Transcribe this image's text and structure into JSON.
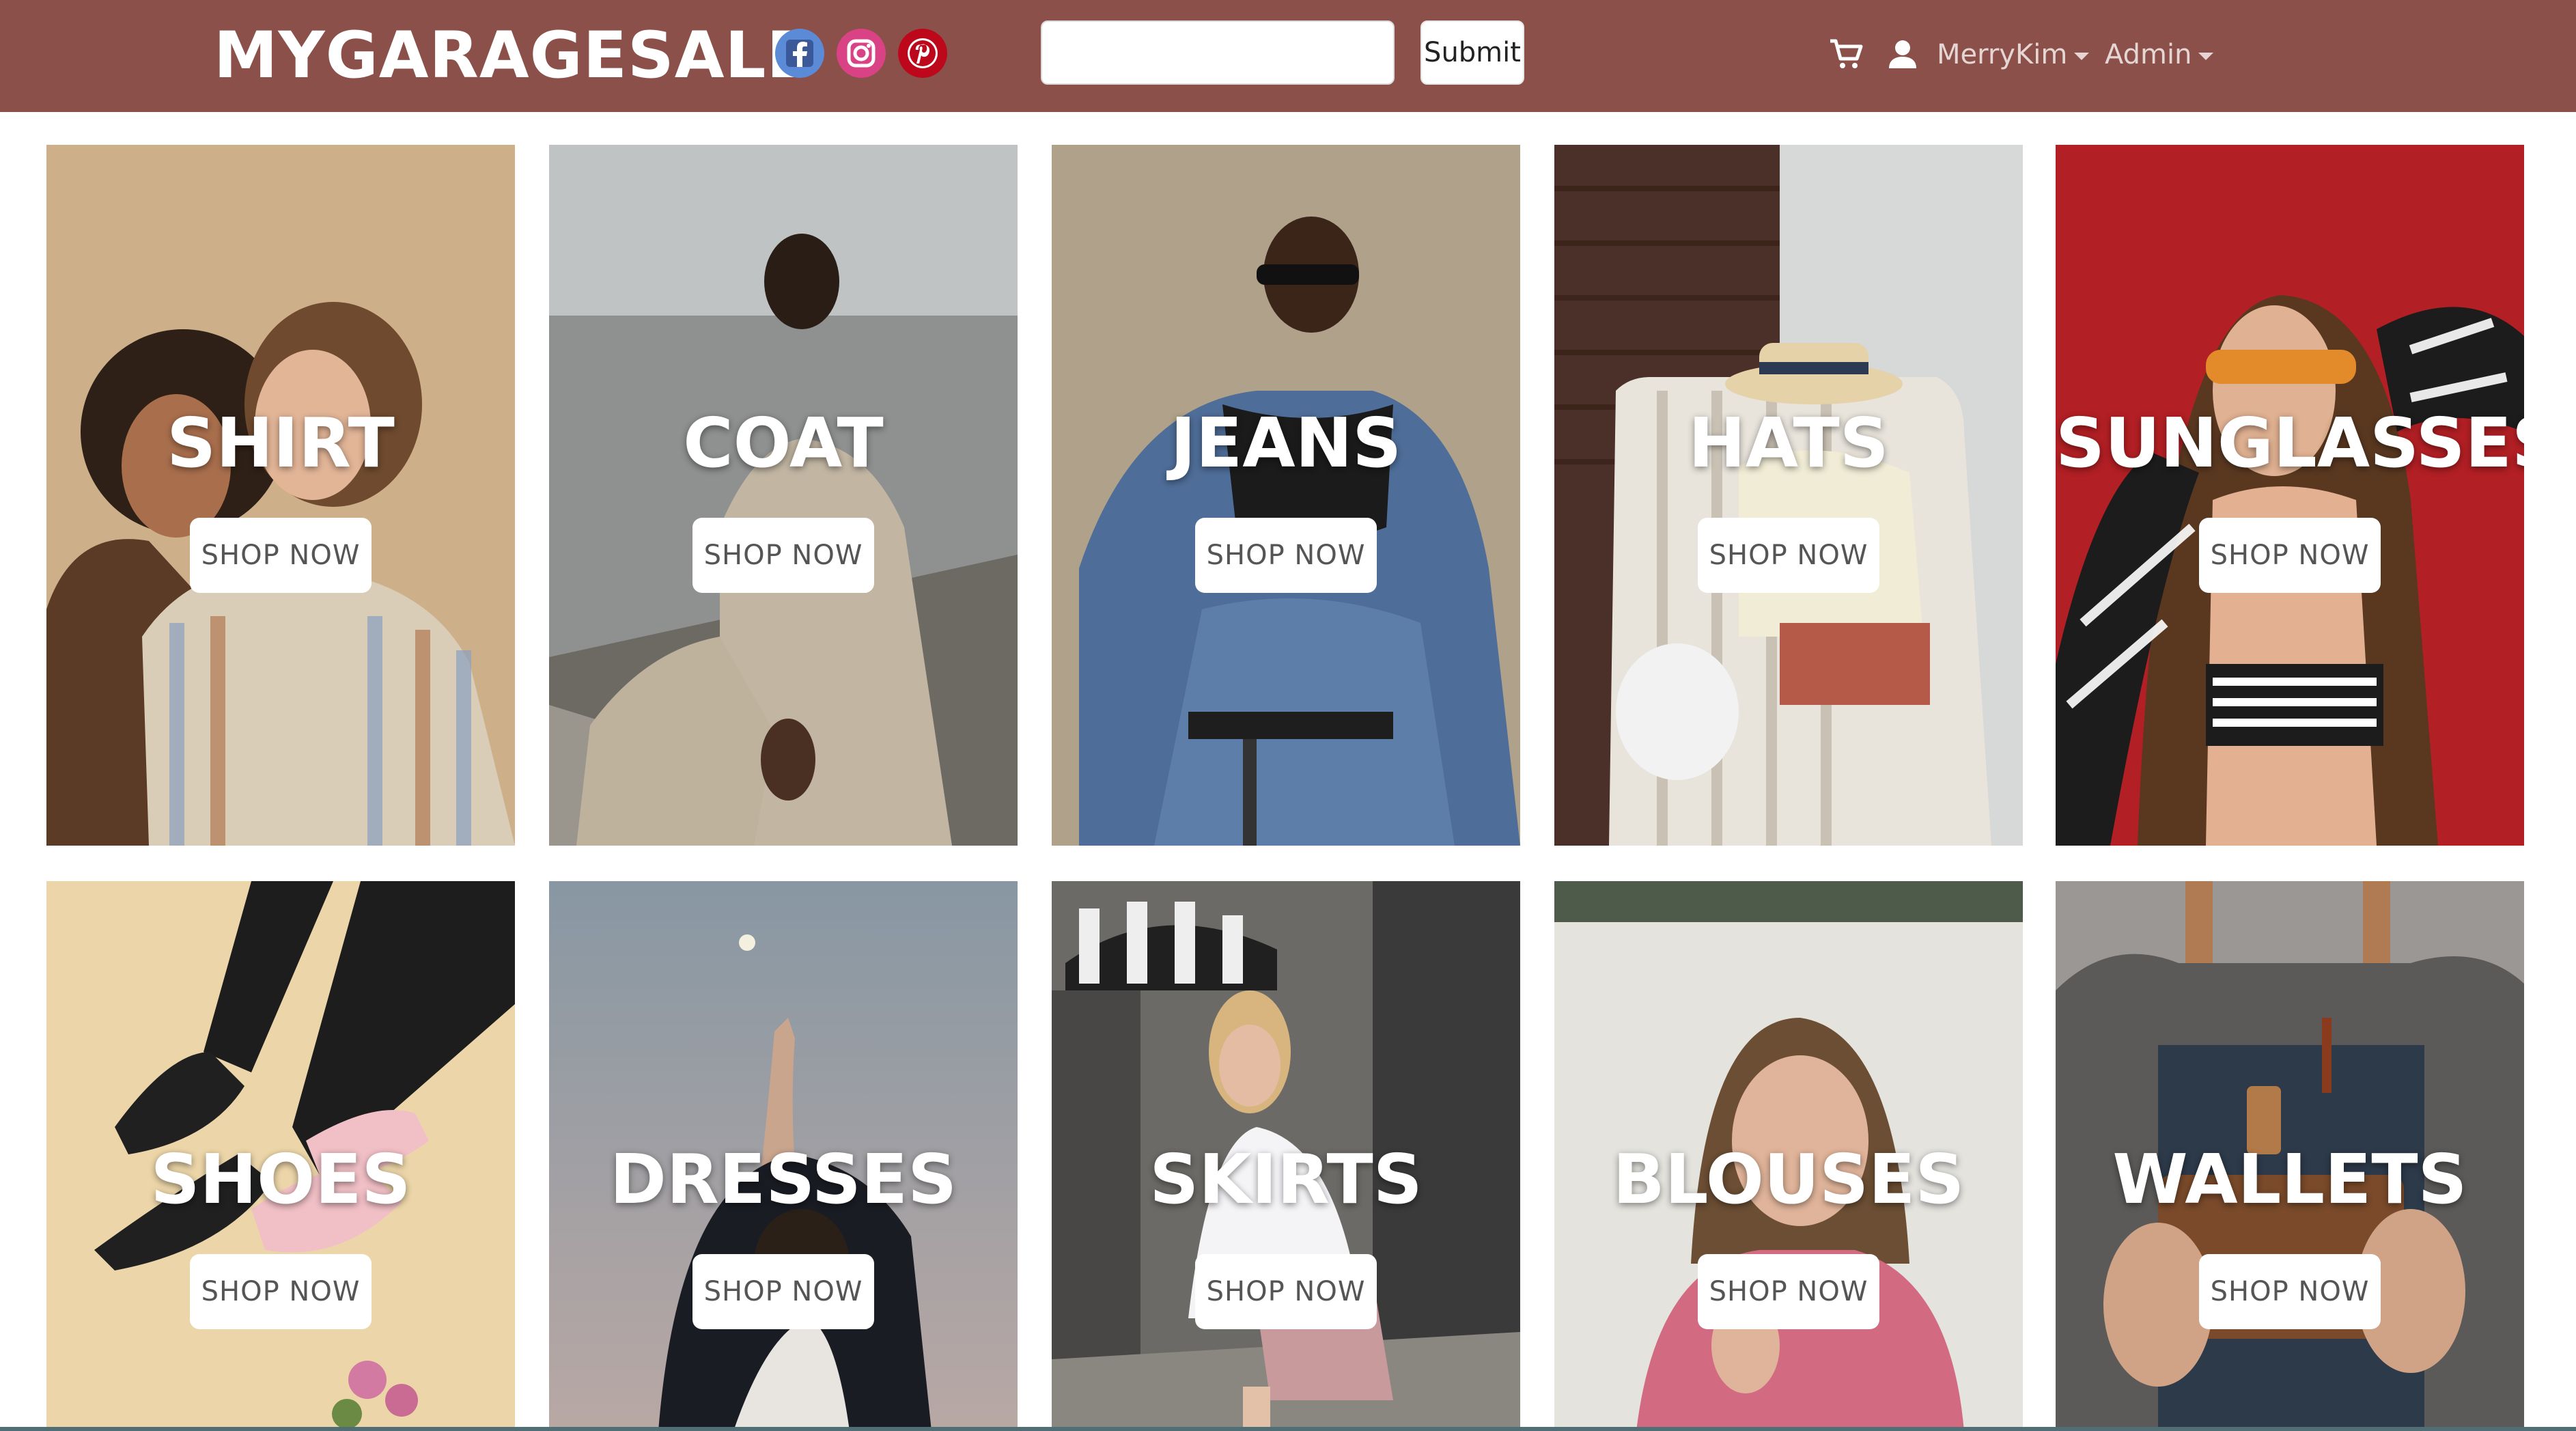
{
  "header": {
    "brand": "MYGARAGESALE",
    "social": [
      {
        "name": "facebook-icon",
        "color": "#3b5998"
      },
      {
        "name": "instagram-icon",
        "color": "#c13584"
      },
      {
        "name": "pinterest-icon",
        "color": "#bd081c"
      }
    ],
    "search": {
      "value": "",
      "placeholder": ""
    },
    "submit_label": "Submit",
    "icons": [
      "cart-icon",
      "user-icon"
    ],
    "user_menu": "MerryKim",
    "admin_menu": "Admin",
    "background": "#8b5049"
  },
  "categories": [
    {
      "title": "SHIRT",
      "button": "SHOP NOW"
    },
    {
      "title": "COAT",
      "button": "SHOP NOW"
    },
    {
      "title": "JEANS",
      "button": "SHOP NOW"
    },
    {
      "title": "HATS",
      "button": "SHOP NOW"
    },
    {
      "title": "SUNGLASSES",
      "button": "SHOP NOW"
    },
    {
      "title": "SHOES",
      "button": "SHOP NOW"
    },
    {
      "title": "DRESSES",
      "button": "SHOP NOW"
    },
    {
      "title": "SKIRTS",
      "button": "SHOP NOW"
    },
    {
      "title": "BLOUSES",
      "button": "SHOP NOW"
    },
    {
      "title": "WALLETS",
      "button": "SHOP NOW"
    }
  ]
}
